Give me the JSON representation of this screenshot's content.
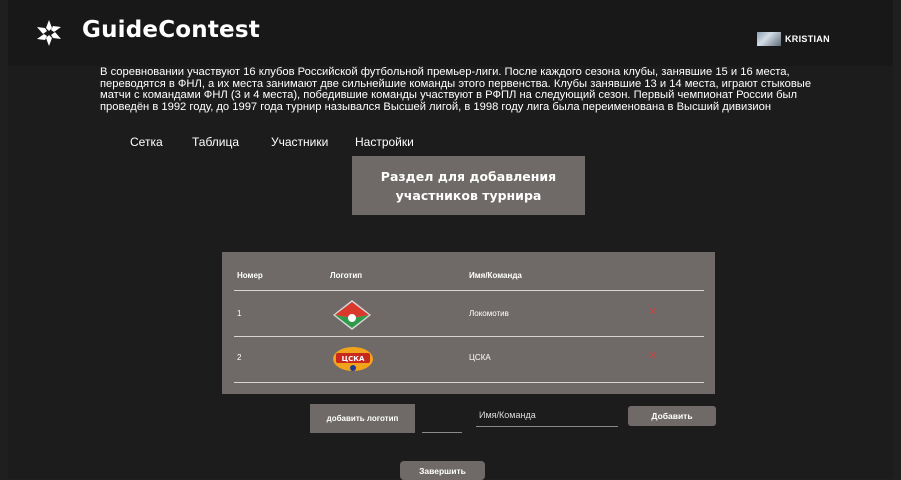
{
  "header": {
    "brand": "GuideContest",
    "user_name": "KRISTIAN"
  },
  "description": "В соревновании участвуют 16 клубов Российской футбольной премьер-лиги. После каждого сезона клубы, занявшие 15 и 16 места, переводятся в ФНЛ, а их места занимают две сильнейшие команды этого первенства. Клубы занявшие 13 и 14 места, играют стыковые матчи с командами ФНЛ (3 и 4 места), победившие команды участвуют в РФПЛ на следующий сезон. Первый чемпионат России был проведён в 1992 году, до 1997 года турнир назывался Высшей лигой, в 1998 году лига была переименована в Высший дивизион",
  "tabs": [
    "Сетка",
    "Таблица",
    "Участники",
    "Настройки"
  ],
  "section_title": "Раздел для добавления участников турнира",
  "table": {
    "headers": {
      "number": "Номер",
      "logo": "Логотип",
      "name": "Имя/Команда"
    },
    "rows": [
      {
        "number": "1",
        "logo_icon": "lokomotiv-logo-icon",
        "name": "Локомотив",
        "delete": "×"
      },
      {
        "number": "2",
        "logo_icon": "cska-logo-icon",
        "name": "ЦСКА",
        "delete": "×"
      }
    ]
  },
  "cska_emblem_text": "ЦСКА",
  "form": {
    "add_logo_label": "добавить логотип",
    "name_placeholder": "Имя/Команда",
    "add_label": "Добавить"
  },
  "finish_label": "Завершить",
  "colors": {
    "background": "#1c1c1c",
    "panel": "#6f6a67",
    "delete": "#e23b3b"
  }
}
